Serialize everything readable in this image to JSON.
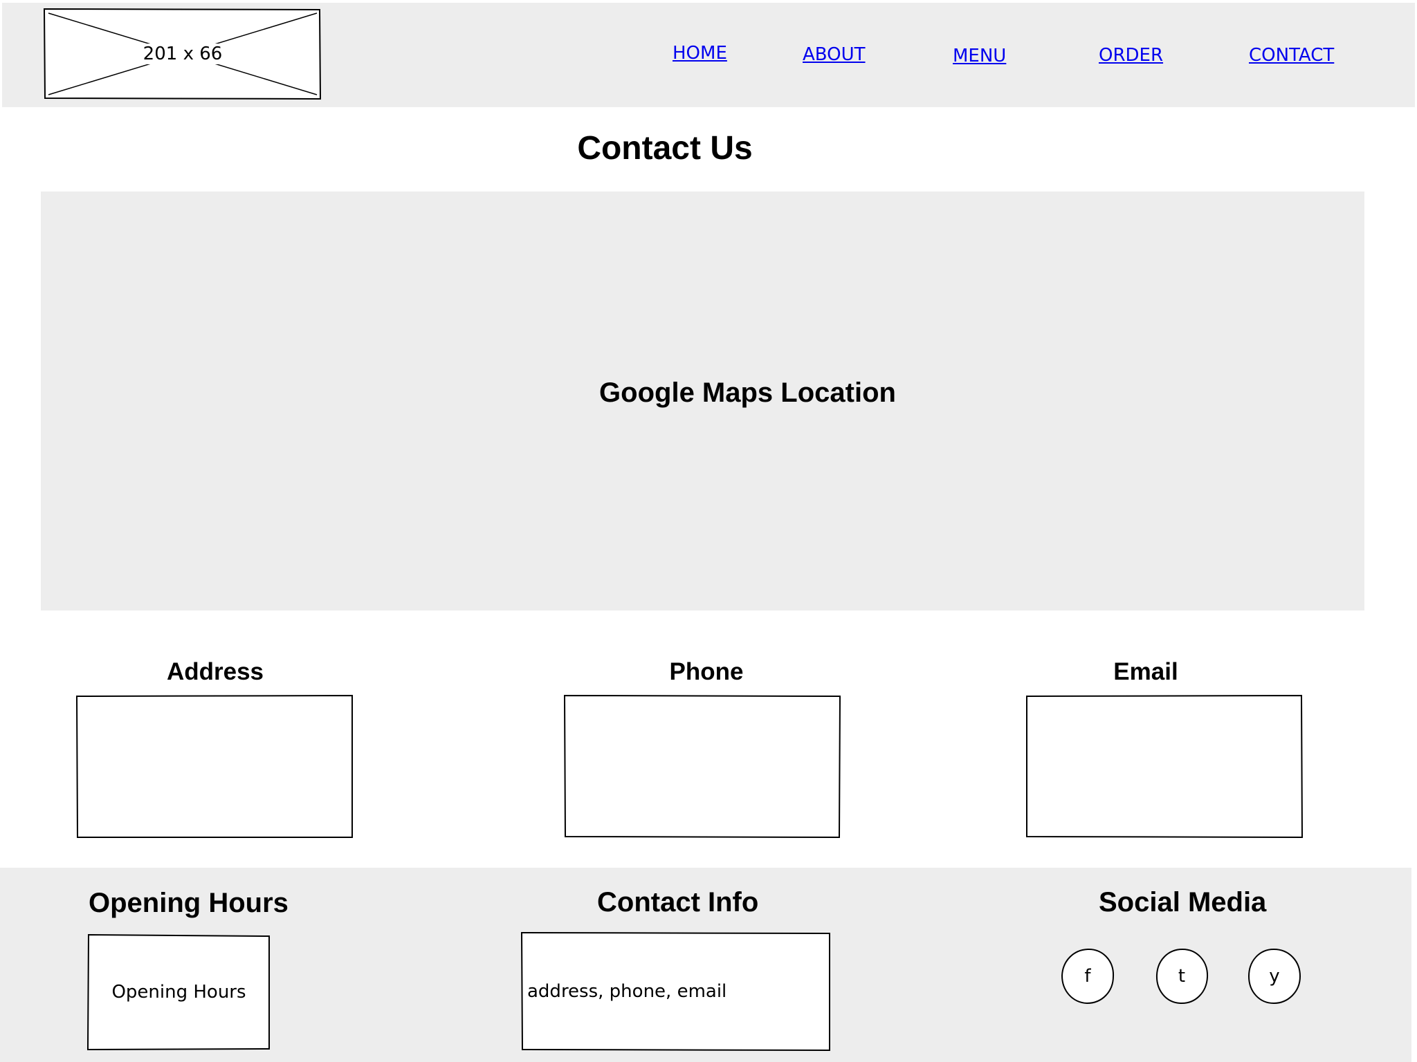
{
  "header": {
    "logo_placeholder": "201 x 66",
    "nav": [
      "HOME",
      "ABOUT",
      "MENU",
      "ORDER",
      "CONTACT"
    ]
  },
  "page": {
    "title": "Contact Us",
    "map_label": "Google Maps Location"
  },
  "info": {
    "address_label": "Address",
    "phone_label": "Phone",
    "email_label": "Email"
  },
  "footer": {
    "opening_hours_title": "Opening Hours",
    "opening_hours_box": "Opening Hours",
    "contact_info_title": "Contact Info",
    "contact_info_box": "address, phone, email",
    "social_title": "Social Media",
    "social_icons": [
      "f",
      "t",
      "y"
    ]
  },
  "colors": {
    "panel_background": "#ededed",
    "link": "#0000ee"
  },
  "icons": [
    "facebook-icon",
    "twitter-icon",
    "youtube-icon"
  ]
}
